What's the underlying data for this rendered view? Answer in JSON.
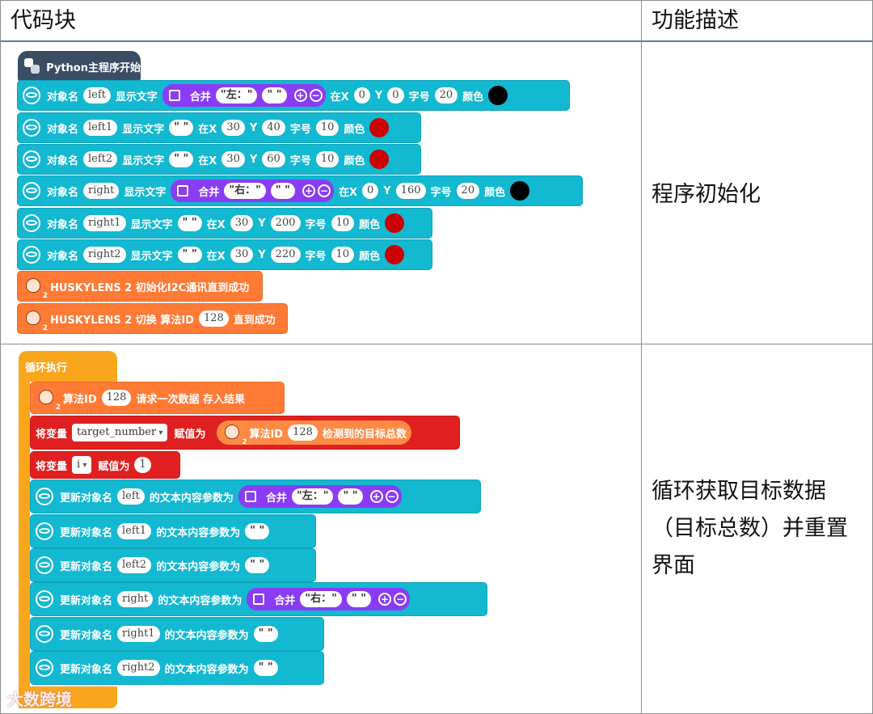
{
  "headers": {
    "col1": "代码块",
    "col2": "功能描述"
  },
  "descriptions": {
    "init": "程序初始化",
    "loop": [
      "循环获取目标数据",
      "（目标总数）并重置",
      "界面"
    ]
  },
  "python_start": "Python主程序开始",
  "labels": {
    "obj_name": "对象名",
    "show_text": "显示文字",
    "merge": "合并",
    "at_x": "在X",
    "y": "Y",
    "font_size": "字号",
    "color": "颜色",
    "loop": "循环执行",
    "set_var": "将变量",
    "assign": "赋值为",
    "update_obj": "更新对象名",
    "text_param": "的文本内容参数为",
    "algo_id": "算法ID"
  },
  "init_rows": [
    {
      "name": "left",
      "text_merge": true,
      "merge_a": "\"左：\"",
      "merge_b": "\" \"",
      "x": "0",
      "y": "0",
      "size": "20",
      "color": "#000000"
    },
    {
      "name": "left1",
      "text": "\" \"",
      "x": "30",
      "y": "40",
      "size": "10",
      "color": "#cc0000"
    },
    {
      "name": "left2",
      "text": "\" \"",
      "x": "30",
      "y": "60",
      "size": "10",
      "color": "#cc0000"
    },
    {
      "name": "right",
      "text_merge": true,
      "merge_a": "\"右：\"",
      "merge_b": "\" \"",
      "x": "0",
      "y": "160",
      "size": "20",
      "color": "#000000"
    },
    {
      "name": "right1",
      "text": "\" \"",
      "x": "30",
      "y": "200",
      "size": "10",
      "color": "#cc0000"
    },
    {
      "name": "right2",
      "text": "\" \"",
      "x": "30",
      "y": "220",
      "size": "10",
      "color": "#cc0000"
    }
  ],
  "husky_init": "HUSKYLENS 2 初始化I2C通讯直到成功",
  "husky_switch": {
    "prefix": "HUSKYLENS 2 切换 算法ID",
    "id": "128",
    "suffix": "直到成功"
  },
  "loop_blocks": {
    "request": {
      "algo": "算法ID",
      "id": "128",
      "text": "请求一次数据 存入结果"
    },
    "set_target": {
      "var": "target_number",
      "inner_algo": "算法ID",
      "id": "128",
      "inner_text": "检测到的目标总数"
    },
    "set_i": {
      "var": "i",
      "value": "1"
    }
  },
  "update_rows": [
    {
      "name": "left",
      "merge": true,
      "a": "\"左：\"",
      "b": "\" \""
    },
    {
      "name": "left1",
      "value": "\" \""
    },
    {
      "name": "left2",
      "value": "\" \""
    },
    {
      "name": "right",
      "merge": true,
      "a": "\"右：\"",
      "b": "\" \""
    },
    {
      "name": "right1",
      "value": "\" \""
    },
    {
      "name": "right2",
      "value": "\" \""
    }
  ],
  "watermark": "大数跨境",
  "colors": {
    "cyan": "#13b8d1",
    "orange": "#ff7a35",
    "red": "#e02020",
    "yellow": "#f9a61c",
    "purple": "#8a3cf5",
    "navy": "#3a4d63"
  }
}
